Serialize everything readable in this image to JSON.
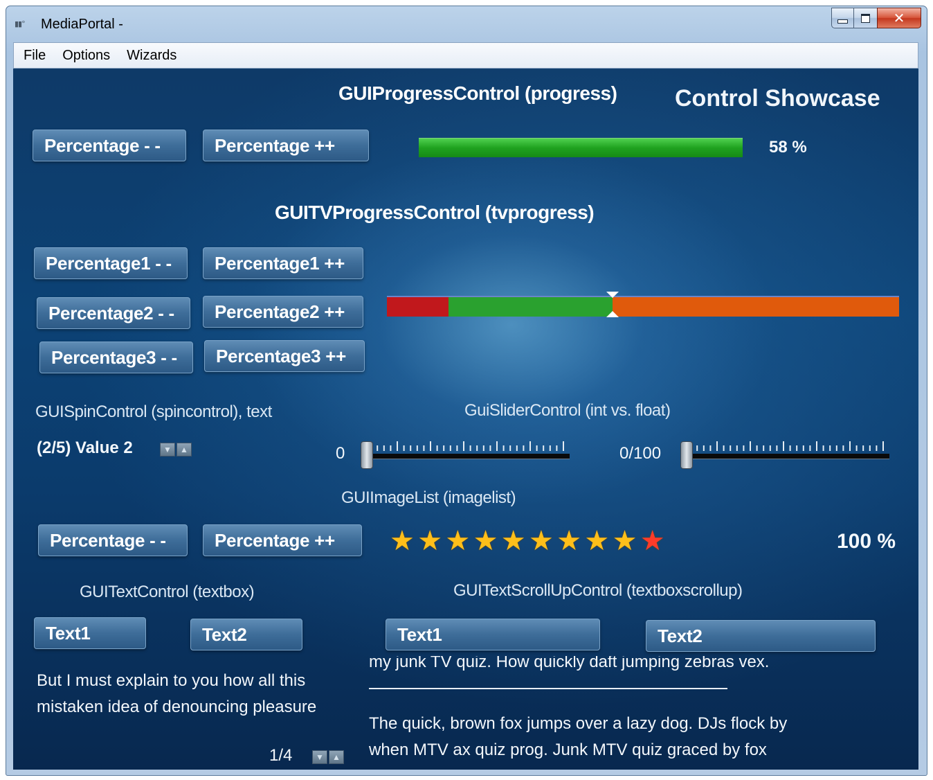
{
  "window": {
    "title": "MediaPortal -",
    "app_icon": "mediaportal-icon",
    "caption_buttons": {
      "minimize": "minimize-icon",
      "maximize": "maximize-icon",
      "close": "✕"
    }
  },
  "menu": [
    "File",
    "Options",
    "Wizards"
  ],
  "progress": {
    "heading": "GUIProgressControl (progress)",
    "showcase_title": "Control Showcase",
    "dec_label": "Percentage - -",
    "inc_label": "Percentage ++",
    "percent": 58,
    "percent_text": "58 %",
    "fill_color": "#1fa21f"
  },
  "tvprogress": {
    "heading": "GUITVProgressControl (tvprogress)",
    "buttons": [
      {
        "dec": "Percentage1 - -",
        "inc": "Percentage1 ++"
      },
      {
        "dec": "Percentage2 - -",
        "inc": "Percentage2 ++"
      },
      {
        "dec": "Percentage3 - -",
        "inc": "Percentage3 ++"
      }
    ],
    "segments": [
      {
        "color": "#c1181c",
        "fraction": 0.12
      },
      {
        "color": "#2aa12f",
        "fraction": 0.32
      },
      {
        "color": "#e05a0c",
        "fraction": 0.56
      }
    ],
    "marker_fraction": 0.44
  },
  "spin": {
    "heading": "GUISpinControl (spincontrol), text",
    "value": "(2/5) Value 2",
    "arrows": [
      "down-arrow-icon",
      "up-arrow-icon"
    ]
  },
  "slider": {
    "heading": "GuiSliderControl (int vs. float)",
    "int_value": "0",
    "float_value": "0/100",
    "int_level": 0,
    "float_level": 0
  },
  "imagelist": {
    "heading": "GUIImageList (imagelist)",
    "dec_label": "Percentage - -",
    "inc_label": "Percentage ++",
    "stars_total": 10,
    "stars_filled": 10,
    "percent_text": "100 %",
    "star_color": "#ffbf1a",
    "last_star_color": "#ff3b2a"
  },
  "textcontrol": {
    "heading": "GUITextControl (textbox)",
    "btn1": "Text1",
    "btn2": "Text2",
    "lines": [
      "But I must explain to you how all this",
      "mistaken idea of denouncing pleasure"
    ],
    "page": "1/4"
  },
  "textscroll": {
    "heading": "GUITextScrollUpControl (textboxscrollup)",
    "btn1": "Text1",
    "btn2": "Text2",
    "lines": [
      "my junk TV quiz. How quickly daft jumping zebras vex.",
      "The quick, brown fox jumps over a lazy dog. DJs flock by",
      "when MTV ax quiz prog. Junk MTV quiz graced by fox"
    ],
    "divider": "------------------------------------------------------------------"
  }
}
